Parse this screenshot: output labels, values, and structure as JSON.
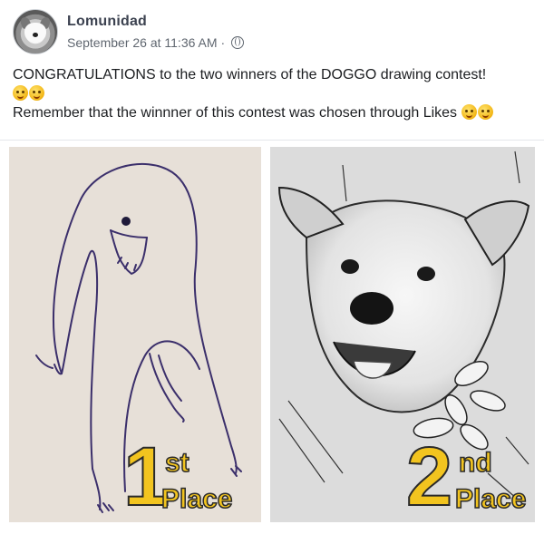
{
  "post": {
    "page_name": "Lomunidad",
    "timestamp": "September 26 at 11:36 AM",
    "separator": "·",
    "line1": "CONGRATULATIONS to the two winners of the DOGGO drawing contest!",
    "line2": "Remember that the winnner of this contest was chosen through Likes"
  },
  "icons": {
    "audience": "globe-icon",
    "emoji": "grinning-face-with-sweat-emoji"
  },
  "panels": [
    {
      "place_number": "1",
      "place_suffix": "st",
      "place_word": "Place"
    },
    {
      "place_number": "2",
      "place_suffix": "nd",
      "place_word": "Place"
    }
  ],
  "colors": {
    "badge_fill": "#f2c41f",
    "badge_outline": "#2a2a2a",
    "name_color": "#3c4250"
  }
}
